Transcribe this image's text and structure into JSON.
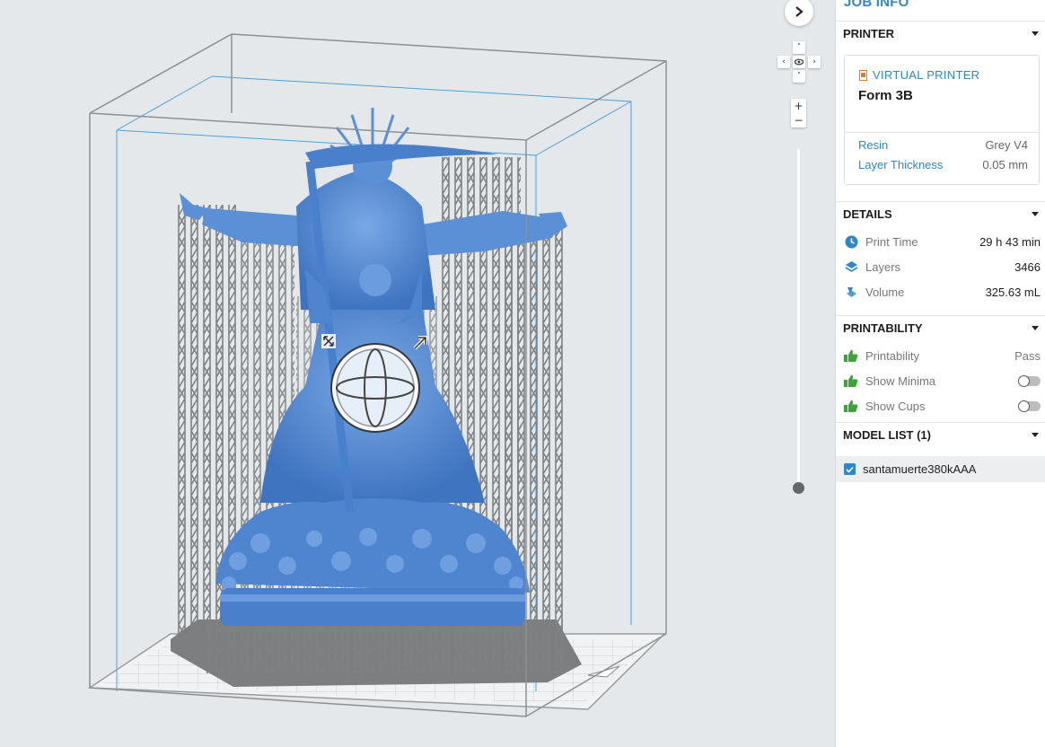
{
  "panel": {
    "title": "JOB INFO",
    "printer": {
      "header": "PRINTER",
      "virtual_label": "VIRTUAL PRINTER",
      "name": "Form 3B",
      "resin_label": "Resin",
      "resin_value": "Grey V4",
      "layer_label": "Layer Thickness",
      "layer_value": "0.05 mm"
    },
    "details": {
      "header": "DETAILS",
      "items": [
        {
          "label": "Print Time",
          "value": "29 h 43 min",
          "icon": "clock-icon"
        },
        {
          "label": "Layers",
          "value": "3466",
          "icon": "layers-icon"
        },
        {
          "label": "Volume",
          "value": "325.63 mL",
          "icon": "volume-icon"
        }
      ]
    },
    "printability": {
      "header": "PRINTABILITY",
      "items": [
        {
          "label": "Printability",
          "value": "Pass",
          "icon": "thumbs-up-icon"
        },
        {
          "label": "Show Minima",
          "toggle": false,
          "icon": "thumbs-up-icon"
        },
        {
          "label": "Show Cups",
          "toggle": false,
          "icon": "thumbs-up-icon"
        }
      ]
    },
    "model_list": {
      "header": "MODEL LIST (1)",
      "items": [
        {
          "name": "santamuerte380kAAA",
          "checked": true
        }
      ]
    }
  },
  "viewport": {
    "controls": [
      "expand-panel",
      "pan-up",
      "pan-left",
      "view-eye",
      "pan-right",
      "pan-down",
      "zoom-in",
      "zoom-out",
      "layer-slider"
    ],
    "colors": {
      "model": "#5b8fd6",
      "supports": "#8e9092",
      "accent": "#2f86c8",
      "good": "#3aa435"
    }
  }
}
